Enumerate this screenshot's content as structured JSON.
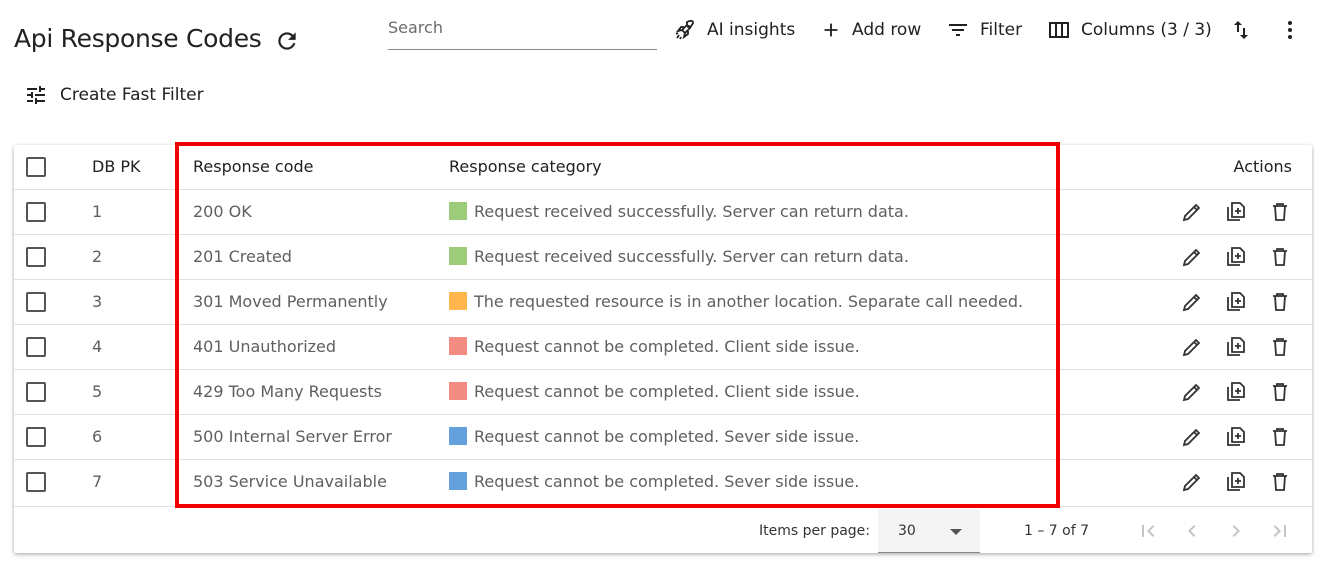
{
  "header": {
    "title": "Api Response Codes",
    "search_placeholder": "Search",
    "ai_insights_label": "AI insights",
    "add_row_label": "Add row",
    "filter_label": "Filter",
    "columns_label": "Columns (3 / 3)",
    "fast_filter_label": "Create Fast Filter"
  },
  "table": {
    "columns": [
      "DB PK",
      "Response code",
      "Response category",
      "Actions"
    ],
    "rows": [
      {
        "pk": "1",
        "code": "200 OK",
        "category": "Request received successfully. Server can return data.",
        "color": "#9ccc7a"
      },
      {
        "pk": "2",
        "code": "201 Created",
        "category": "Request received successfully. Server can return data.",
        "color": "#9ccc7a"
      },
      {
        "pk": "3",
        "code": "301 Moved Permanently",
        "category": "The requested resource is in another location. Separate call needed.",
        "color": "#ffb74d"
      },
      {
        "pk": "4",
        "code": "401 Unauthorized",
        "category": "Request cannot be completed. Client side issue.",
        "color": "#f28b82"
      },
      {
        "pk": "5",
        "code": "429 Too Many Requests",
        "category": "Request cannot be completed. Client side issue.",
        "color": "#f28b82"
      },
      {
        "pk": "6",
        "code": "500 Internal Server Error",
        "category": "Request cannot be completed. Sever side issue.",
        "color": "#64a0dc"
      },
      {
        "pk": "7",
        "code": "503 Service Unavailable",
        "category": "Request cannot be completed. Sever side issue.",
        "color": "#64a0dc"
      }
    ]
  },
  "footer": {
    "items_per_page_label": "Items per page:",
    "items_per_page_value": "30",
    "range_label": "1 – 7 of 7"
  },
  "colors": {
    "highlight": "#f00000"
  }
}
